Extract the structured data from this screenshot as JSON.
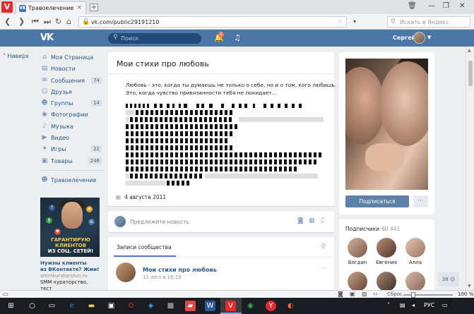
{
  "browser": {
    "logo": "V",
    "tab_favicon": "VK",
    "tab_title": "Травоелечение",
    "tab_close": "×",
    "new_tab": "+",
    "url": "vk.com/public29191210",
    "search_placeholder": "Искать в Яндекс"
  },
  "vk_header": {
    "logo": "VK",
    "search_placeholder": "Поиск",
    "notifications_count": "1",
    "user_name": "Сергей"
  },
  "back_label": "Наверх",
  "menu": {
    "items": [
      {
        "label": "Моя Страница",
        "icon": "home-icon",
        "count": ""
      },
      {
        "label": "Новости",
        "icon": "news-icon",
        "count": ""
      },
      {
        "label": "Сообщения",
        "icon": "messages-icon",
        "count": "74"
      },
      {
        "label": "Друзья",
        "icon": "friends-icon",
        "count": ""
      },
      {
        "label": "Группы",
        "icon": "groups-icon",
        "count": "14"
      },
      {
        "label": "Фотографии",
        "icon": "camera-icon",
        "count": ""
      },
      {
        "label": "Музыка",
        "icon": "music-icon",
        "count": ""
      },
      {
        "label": "Видео",
        "icon": "video-icon",
        "count": ""
      },
      {
        "label": "Игры",
        "icon": "games-icon",
        "count": "22"
      },
      {
        "label": "Товары",
        "icon": "market-icon",
        "count": "246"
      }
    ],
    "extra": {
      "label": "Травоелечение",
      "icon": "group-icon"
    }
  },
  "ad": {
    "image_text_1": "ГАРАНТИРУЮ",
    "image_text_2": "КЛИЕНТОВ",
    "image_text_3": "ИЗ СОЦ. СЕТЕЙ!",
    "title_1": "Нужны клиенты",
    "title_2": "из ВКонтакте? Жми!",
    "site": "smmkuratorstvo.ru",
    "desc_1": "SMM кураторство, тест"
  },
  "post": {
    "title": "Мои стихи про любовь",
    "line_1": "Любовь - это, когда ты думаешь не только о себе, но и о том, кого любишь.",
    "line_2": "Это, когда чувство привязанности тебя не покидает...",
    "date": "4 августа 2011"
  },
  "suggest": {
    "placeholder": "Предложите новость"
  },
  "community_posts": {
    "tab_label": "Записи сообщества",
    "post_name": "Мои стихи про любовь",
    "post_time": "11 июл в 16:16",
    "more": "···"
  },
  "right": {
    "subscribe_label": "Подписаться",
    "more_label": "···",
    "subscribers_label": "Подписчики",
    "subscribers_count": "60 441",
    "people": [
      {
        "name": "Богдан",
        "color": "#b89680"
      },
      {
        "name": "Евгения",
        "color": "#9c7c68"
      },
      {
        "name": "Алла",
        "color": "#c7a690"
      }
    ],
    "counter": "38"
  },
  "status": {
    "reset": "Сброс",
    "zoom": "100 %",
    "zoom_fraction": 0.2
  },
  "taskbar": {
    "lang": "РУС"
  }
}
